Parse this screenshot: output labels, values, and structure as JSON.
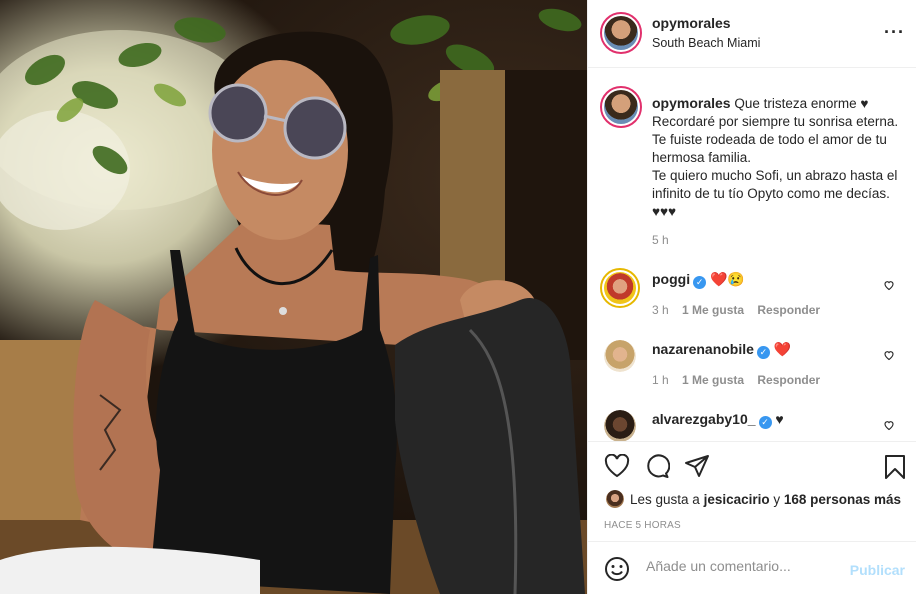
{
  "post": {
    "author": "opymorales",
    "location": "South Beach Miami",
    "more_icon": "more-horizontal-icon"
  },
  "caption": {
    "username": "opymorales",
    "line1": "Que tristeza enorme ♥",
    "line2": "Recordaré por siempre tu sonrisa eterna. Te fuiste rodeada de todo el amor de tu hermosa familia.",
    "line3": "Te quiero mucho Sofi, un abrazo hasta el infinito de tu tío Opyto como me decías. ♥♥♥",
    "time": "5 h"
  },
  "comments": [
    {
      "username": "poggi",
      "verified": true,
      "text": "❤️😢",
      "time": "3 h",
      "likes": "1 Me gusta",
      "reply": "Responder"
    },
    {
      "username": "nazarenanobile",
      "verified": true,
      "text": "❤️",
      "time": "1 h",
      "likes": "1 Me gusta",
      "reply": "Responder"
    },
    {
      "username": "alvarezgaby10_",
      "verified": true,
      "text": "♥",
      "time": "",
      "likes": "",
      "reply": ""
    }
  ],
  "actions": {
    "like_icon": "heart-icon",
    "comment_icon": "comment-icon",
    "share_icon": "share-icon",
    "save_icon": "bookmark-icon"
  },
  "likes": {
    "prefix": "Les gusta a",
    "user": "jesicacirio",
    "connector": "y",
    "others": "168 personas más"
  },
  "time_ago": "HACE 5 HORAS",
  "add_comment": {
    "placeholder": "Añade un comentario...",
    "publish": "Publicar",
    "emoji_icon": "emoji-icon"
  },
  "colors": {
    "link_blue": "#3897f0",
    "publish_disabled": "#b2dffc",
    "story_ring": "#e1306c",
    "text": "#262626",
    "muted": "#8e8e8e"
  }
}
